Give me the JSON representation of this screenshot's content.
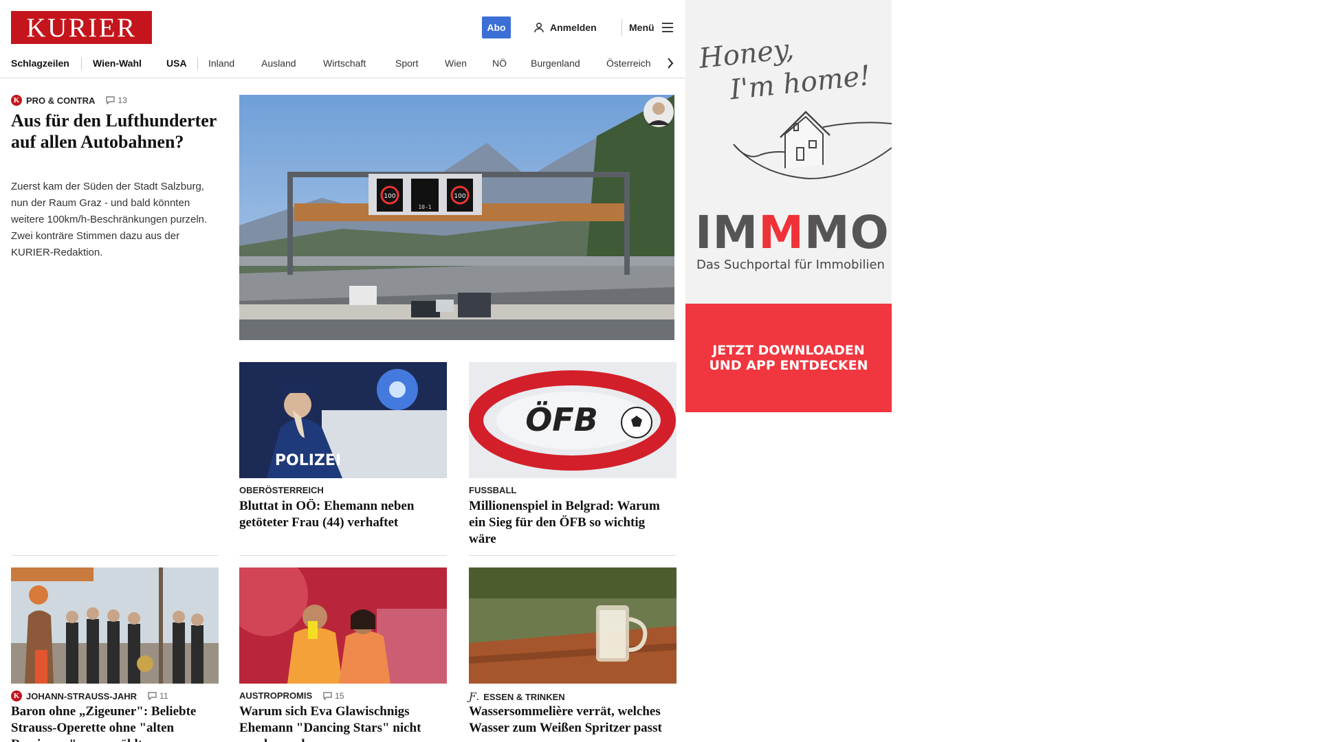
{
  "header": {
    "logo": "KURIER",
    "abo_label": "Abo",
    "login_label": "Anmelden",
    "menu_label": "Menü"
  },
  "nav": {
    "items": [
      "Schlagzeilen",
      "Wien-Wahl",
      "USA",
      "Inland",
      "Ausland",
      "Wirtschaft",
      "Sport",
      "Wien",
      "NÖ",
      "Burgenland",
      "Österreich"
    ]
  },
  "lead": {
    "kicker": "PRO & CONTRA",
    "comments": "13",
    "title": "Aus für den Lufthunderter auf allen Autobahnen?",
    "teaser": "Zuerst kam der Süden der Stadt Salzburg, nun der Raum Graz - und bald könnten weitere 100km/h-Beschränkungen purzeln. Zwei konträre Stimmen dazu aus der KURIER-Redaktion.",
    "sign_left": "100",
    "sign_mid": "10-1",
    "sign_right": "100"
  },
  "cards": [
    {
      "kicker": "OBERÖSTERREICH",
      "title": "Bluttat in OÖ: Ehemann neben getöteter Frau (44) verhaftet",
      "image_text": "POLIZEI"
    },
    {
      "kicker": "FUSSBALL",
      "title": "Millionenspiel in Belgrad: Warum ein Sieg für den ÖFB so wichtig wäre",
      "image_text": "ÖFB"
    },
    {
      "kicker": "JOHANN-STRAUSS-JAHR",
      "comments": "11",
      "title": "Baron ohne „Zigeuner\": Beliebte Strauss-Operette ohne \"alten Rassismus\" neu erzählt"
    },
    {
      "kicker": "AUSTROPROMIS",
      "comments": "15",
      "title": "Warum sich Eva Glawischnigs Ehemann \"Dancing Stars\" nicht anschauen kann"
    },
    {
      "kicker": "ESSEN & TRINKEN",
      "title": "Wassersommelière verrät, welches Wasser zum Weißen Spritzer passt"
    }
  ],
  "ad": {
    "script_line1": "Honey,",
    "script_line2": "I'm home!",
    "brand_1": "IM",
    "brand_2": "M",
    "brand_3": "MO",
    "tagline": "Das Suchportal für Immobilien",
    "cta_line1": "JETZT DOWNLOADEN",
    "cta_line2": "UND APP ENTDECKEN"
  },
  "colors": {
    "brand_red": "#c4151c",
    "abo_blue": "#3b6fd6",
    "ad_red": "#f0363e"
  }
}
